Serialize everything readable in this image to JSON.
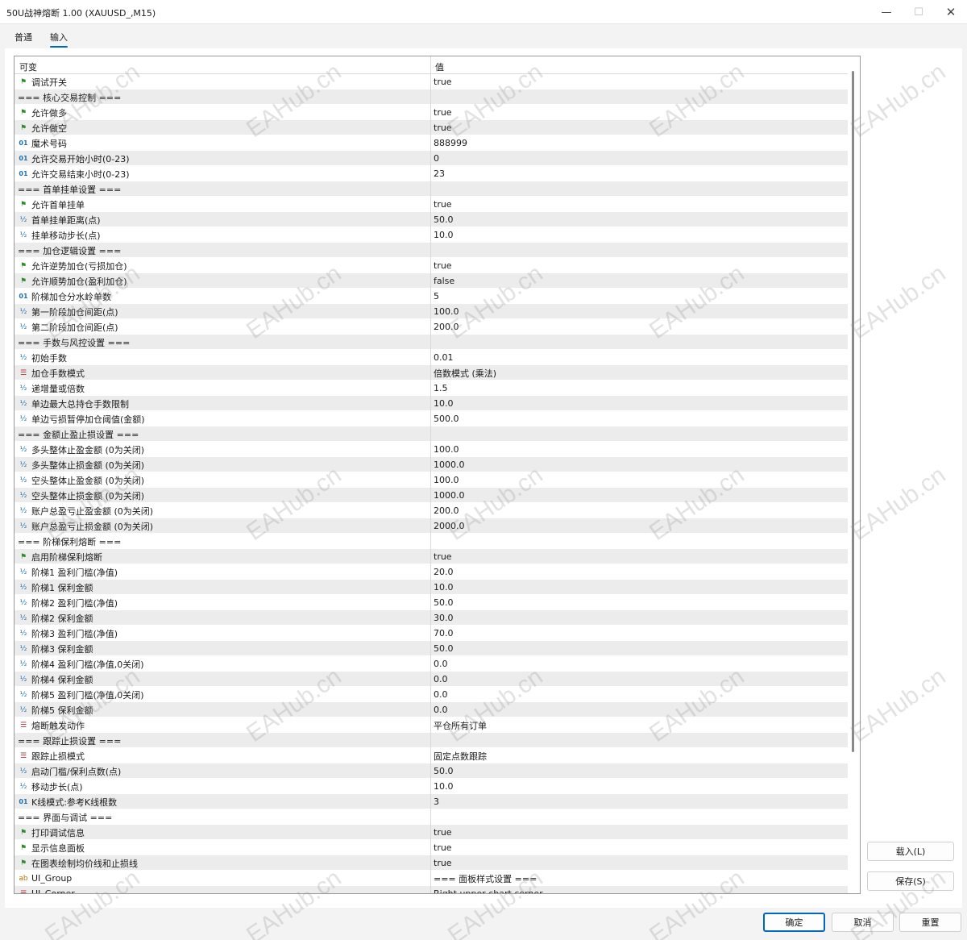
{
  "window": {
    "title": "50U战神熔断 1.00 (XAUUSD_,M15)",
    "minimize_icon": "minimize-icon",
    "maximize_icon": "maximize-icon",
    "close_icon": "close-icon"
  },
  "tabs": [
    {
      "label": "普通",
      "active": false
    },
    {
      "label": "输入",
      "active": true
    }
  ],
  "grid": {
    "header_name": "可变",
    "header_value": "值",
    "rows": [
      {
        "icon": "bool",
        "name": "调试开关",
        "value": "true"
      },
      {
        "icon": "none",
        "name": "=== 核心交易控制 ===",
        "value": ""
      },
      {
        "icon": "bool",
        "name": "允许做多",
        "value": "true"
      },
      {
        "icon": "bool",
        "name": "允许做空",
        "value": "true"
      },
      {
        "icon": "int",
        "name": "魔术号码",
        "value": "888999"
      },
      {
        "icon": "int",
        "name": "允许交易开始小时(0-23)",
        "value": "0"
      },
      {
        "icon": "int",
        "name": "允许交易结束小时(0-23)",
        "value": "23"
      },
      {
        "icon": "none",
        "name": "=== 首单挂单设置 ===",
        "value": ""
      },
      {
        "icon": "bool",
        "name": "允许首单挂单",
        "value": "true"
      },
      {
        "icon": "dbl",
        "name": "首单挂单距离(点)",
        "value": "50.0"
      },
      {
        "icon": "dbl",
        "name": "挂单移动步长(点)",
        "value": "10.0"
      },
      {
        "icon": "none",
        "name": "=== 加仓逻辑设置 ===",
        "value": ""
      },
      {
        "icon": "bool",
        "name": "允许逆势加仓(亏损加仓)",
        "value": "true"
      },
      {
        "icon": "bool",
        "name": "允许顺势加仓(盈利加仓)",
        "value": "false"
      },
      {
        "icon": "int",
        "name": "阶梯加仓分水岭单数",
        "value": "5"
      },
      {
        "icon": "dbl",
        "name": "第一阶段加仓间距(点)",
        "value": "100.0"
      },
      {
        "icon": "dbl",
        "name": "第二阶段加仓间距(点)",
        "value": "200.0"
      },
      {
        "icon": "none",
        "name": "=== 手数与风控设置 ===",
        "value": ""
      },
      {
        "icon": "dbl",
        "name": "初始手数",
        "value": "0.01"
      },
      {
        "icon": "enum",
        "name": "加仓手数模式",
        "value": "倍数模式 (乘法)"
      },
      {
        "icon": "dbl",
        "name": "递增量或倍数",
        "value": "1.5"
      },
      {
        "icon": "dbl",
        "name": "单边最大总持仓手数限制",
        "value": "10.0"
      },
      {
        "icon": "dbl",
        "name": "单边亏损暂停加仓阈值(金额)",
        "value": "500.0"
      },
      {
        "icon": "none",
        "name": "=== 金额止盈止损设置 ===",
        "value": ""
      },
      {
        "icon": "dbl",
        "name": "多头整体止盈金额 (0为关闭)",
        "value": "100.0"
      },
      {
        "icon": "dbl",
        "name": "多头整体止损金额 (0为关闭)",
        "value": "1000.0"
      },
      {
        "icon": "dbl",
        "name": "空头整体止盈金额 (0为关闭)",
        "value": "100.0"
      },
      {
        "icon": "dbl",
        "name": "空头整体止损金额 (0为关闭)",
        "value": "1000.0"
      },
      {
        "icon": "dbl",
        "name": "账户总盈亏止盈金额 (0为关闭)",
        "value": "200.0"
      },
      {
        "icon": "dbl",
        "name": "账户总盈亏止损金额 (0为关闭)",
        "value": "2000.0"
      },
      {
        "icon": "none",
        "name": "=== 阶梯保利熔断 ===",
        "value": ""
      },
      {
        "icon": "bool",
        "name": "启用阶梯保利熔断",
        "value": "true"
      },
      {
        "icon": "dbl",
        "name": "阶梯1 盈利门槛(净值)",
        "value": "20.0"
      },
      {
        "icon": "dbl",
        "name": "阶梯1 保利金额",
        "value": "10.0"
      },
      {
        "icon": "dbl",
        "name": "阶梯2 盈利门槛(净值)",
        "value": "50.0"
      },
      {
        "icon": "dbl",
        "name": "阶梯2 保利金额",
        "value": "30.0"
      },
      {
        "icon": "dbl",
        "name": "阶梯3 盈利门槛(净值)",
        "value": "70.0"
      },
      {
        "icon": "dbl",
        "name": "阶梯3 保利金额",
        "value": "50.0"
      },
      {
        "icon": "dbl",
        "name": "阶梯4 盈利门槛(净值,0关闭)",
        "value": "0.0"
      },
      {
        "icon": "dbl",
        "name": "阶梯4 保利金额",
        "value": "0.0"
      },
      {
        "icon": "dbl",
        "name": "阶梯5 盈利门槛(净值,0关闭)",
        "value": "0.0"
      },
      {
        "icon": "dbl",
        "name": "阶梯5 保利金额",
        "value": "0.0"
      },
      {
        "icon": "enum",
        "name": "熔断触发动作",
        "value": "平仓所有订单"
      },
      {
        "icon": "none",
        "name": "=== 跟踪止损设置 ===",
        "value": ""
      },
      {
        "icon": "enum",
        "name": "跟踪止损模式",
        "value": "固定点数跟踪"
      },
      {
        "icon": "dbl",
        "name": "启动门槛/保利点数(点)",
        "value": "50.0"
      },
      {
        "icon": "dbl",
        "name": "移动步长(点)",
        "value": "10.0"
      },
      {
        "icon": "int",
        "name": "K线模式:参考K线根数",
        "value": "3"
      },
      {
        "icon": "none",
        "name": "=== 界面与调试 ===",
        "value": ""
      },
      {
        "icon": "bool",
        "name": "打印调试信息",
        "value": "true"
      },
      {
        "icon": "bool",
        "name": "显示信息面板",
        "value": "true"
      },
      {
        "icon": "bool",
        "name": "在图表绘制均价线和止损线",
        "value": "true"
      },
      {
        "icon": "str",
        "name": "UI_Group",
        "value": "=== 面板样式设置 ==="
      },
      {
        "icon": "enum",
        "name": "UI_Corner",
        "value": "Right upper chart corner"
      }
    ]
  },
  "buttons": {
    "load": "载入(L)",
    "save": "保存(S)",
    "ok": "确定",
    "cancel": "取消",
    "reset": "重置"
  },
  "watermark_text": "EAHub.cn",
  "colors": {
    "accent": "#0067c0",
    "row_alt": "#ececec",
    "bool_icon": "#2e8b2e",
    "number_icon": "#1f6fb5",
    "enum_icon": "#b03030"
  }
}
